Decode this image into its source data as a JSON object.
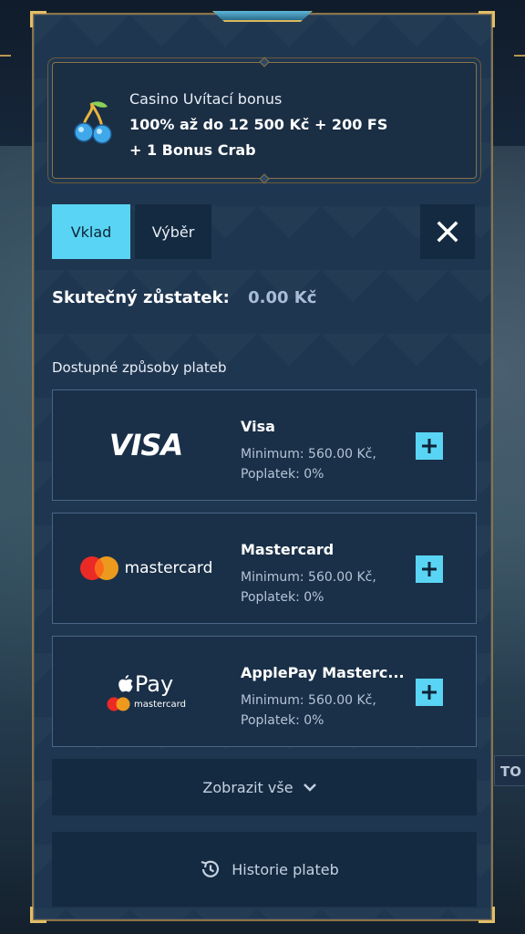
{
  "bonus": {
    "title": "Casino Uvítací bonus",
    "line1": "100% až do 12 500 Kč + 200 FS",
    "line2": "+ 1 Bonus Crab"
  },
  "tabs": [
    {
      "label": "Vklad",
      "active": true
    },
    {
      "label": "Výběr",
      "active": false
    }
  ],
  "balance": {
    "label": "Skutečný zůstatek:",
    "value": "0.00 Kč"
  },
  "methods_title": "Dostupné způsoby plateb",
  "methods": [
    {
      "name": "Visa",
      "minimum": "Minimum: 560.00 Kč,",
      "fee": "Poplatek: 0%",
      "logo": "VISA"
    },
    {
      "name": "Mastercard",
      "minimum": "Minimum: 560.00 Kč,",
      "fee": "Poplatek: 0%",
      "logo": "mastercard"
    },
    {
      "name": "ApplePay Masterc...",
      "minimum": "Minimum: 560.00 Kč,",
      "fee": "Poplatek: 0%",
      "logo_top": "Pay",
      "logo_bottom": "mastercard"
    }
  ],
  "show_all": "Zobrazit vše",
  "history": "Historie plateb",
  "background_label": "TO",
  "colors": {
    "accent": "#5ad4f4",
    "panel": "#1f3650",
    "gold": "#8b7446"
  }
}
